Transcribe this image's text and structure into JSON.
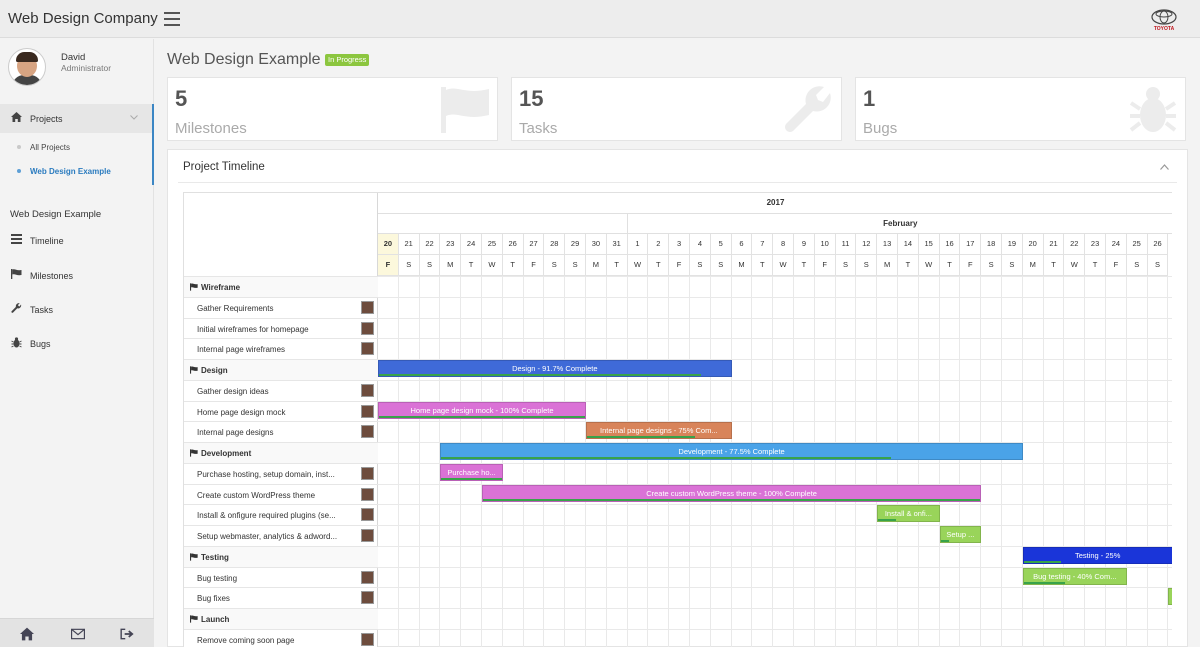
{
  "app": {
    "brand": "Web Design Company",
    "logo_text": "TOYOTA"
  },
  "user": {
    "name": "David",
    "role": "Administrator"
  },
  "sidebar": {
    "projects_label": "Projects",
    "sub_items": [
      {
        "label": "All Projects"
      },
      {
        "label": "Web Design Example"
      }
    ],
    "section_title": "Web Design Example",
    "links": [
      {
        "label": "Timeline"
      },
      {
        "label": "Milestones"
      },
      {
        "label": "Tasks"
      },
      {
        "label": "Bugs"
      }
    ]
  },
  "page": {
    "title": "Web Design Example",
    "status": "In Progress"
  },
  "stats": [
    {
      "value": "5",
      "label": "Milestones",
      "icon": "flag-icon"
    },
    {
      "value": "15",
      "label": "Tasks",
      "icon": "wrench-icon"
    },
    {
      "value": "1",
      "label": "Bugs",
      "icon": "bug-icon"
    }
  ],
  "panel": {
    "title": "Project Timeline"
  },
  "timeline": {
    "year": "2017",
    "month": "February",
    "days": [
      "20",
      "21",
      "22",
      "23",
      "24",
      "25",
      "26",
      "27",
      "28",
      "29",
      "30",
      "31",
      "1",
      "2",
      "3",
      "4",
      "5",
      "6",
      "7",
      "8",
      "9",
      "10",
      "11",
      "12",
      "13",
      "14",
      "15",
      "16",
      "17",
      "18",
      "19",
      "20",
      "21",
      "22",
      "23",
      "24",
      "25",
      "26"
    ],
    "weekdays": [
      "F",
      "S",
      "S",
      "M",
      "T",
      "W",
      "T",
      "F",
      "S",
      "S",
      "M",
      "T",
      "W",
      "T",
      "F",
      "S",
      "S",
      "M",
      "T",
      "W",
      "T",
      "F",
      "S",
      "S",
      "M",
      "T",
      "W",
      "T",
      "F",
      "S",
      "S",
      "M",
      "T",
      "W",
      "T",
      "F",
      "S",
      "S"
    ],
    "today_index": 0
  },
  "tasks": [
    {
      "name": "Wireframe",
      "milestone": true
    },
    {
      "name": "Gather Requirements"
    },
    {
      "name": "Initial wireframes for homepage"
    },
    {
      "name": "Internal page wireframes"
    },
    {
      "name": "Design",
      "milestone": true
    },
    {
      "name": "Gather design ideas"
    },
    {
      "name": "Home page design mock"
    },
    {
      "name": "Internal page designs"
    },
    {
      "name": "Development",
      "milestone": true
    },
    {
      "name": "Purchase hosting, setup domain, inst..."
    },
    {
      "name": "Create custom WordPress theme"
    },
    {
      "name": "Install & onfigure required plugins (se..."
    },
    {
      "name": "Setup webmaster, analytics & adword..."
    },
    {
      "name": "Testing",
      "milestone": true
    },
    {
      "name": "Bug testing"
    },
    {
      "name": "Bug fixes"
    },
    {
      "name": "Launch",
      "milestone": true
    },
    {
      "name": "Remove coming soon page"
    }
  ],
  "bars": [
    {
      "row": 4,
      "start": 0,
      "end": 17,
      "label": "Design - 91.7% Complete",
      "color": "#3f6ad8",
      "progress": 0.917
    },
    {
      "row": 6,
      "start": 0,
      "end": 10,
      "label": "Home page design mock - 100% Complete",
      "color": "#da72d6",
      "progress": 1.0
    },
    {
      "row": 7,
      "start": 10,
      "end": 17,
      "label": "Internal page designs - 75% Com...",
      "color": "#d8845a",
      "progress": 0.75
    },
    {
      "row": 8,
      "start": 3,
      "end": 31,
      "label": "Development - 77.5% Complete",
      "color": "#4aa3e8",
      "progress": 0.775
    },
    {
      "row": 9,
      "start": 3,
      "end": 6,
      "label": "Purchase ho...",
      "color": "#da72d6",
      "progress": 1.0
    },
    {
      "row": 10,
      "start": 5,
      "end": 29,
      "label": "Create custom WordPress theme - 100% Complete",
      "color": "#da72d6",
      "progress": 1.0
    },
    {
      "row": 11,
      "start": 24,
      "end": 27,
      "label": "Install & onfi...",
      "color": "#99d45a",
      "progress": 0.3
    },
    {
      "row": 12,
      "start": 27,
      "end": 29,
      "label": "Setup ...",
      "color": "#99d45a",
      "progress": 0.2
    },
    {
      "row": 13,
      "start": 31,
      "end": 38.2,
      "label": "Testing - 25%",
      "color": "#1a35d9",
      "progress": 0.25
    },
    {
      "row": 14,
      "start": 31,
      "end": 36,
      "label": "Bug testing - 40% Com...",
      "color": "#99d45a",
      "progress": 0.4
    },
    {
      "row": 15,
      "start": 38,
      "end": 38.4,
      "label": "",
      "color": "#99d45a",
      "progress": 0.0
    }
  ]
}
